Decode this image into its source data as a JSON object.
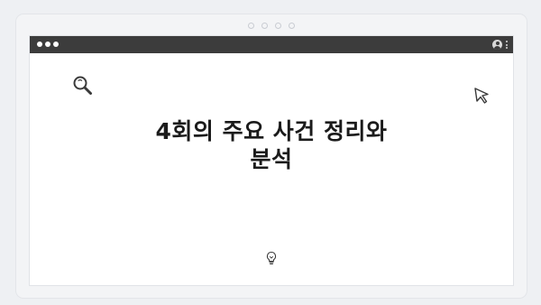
{
  "window": {
    "controls": [
      "close",
      "minimize",
      "maximize"
    ],
    "title_bar_color": "#3c3c3c"
  },
  "icons": {
    "search": "search-icon",
    "cursor": "cursor-arrow-icon",
    "profile": "profile-icon",
    "menu": "kebab-menu-icon",
    "hint": "lightbulb-icon"
  },
  "content": {
    "title_line1": "4회의 주요 사건 정리와",
    "title_line2": "분석"
  },
  "colors": {
    "page_background": "#eef0f3",
    "window_background": "#ffffff",
    "text": "#1b1b1b"
  }
}
